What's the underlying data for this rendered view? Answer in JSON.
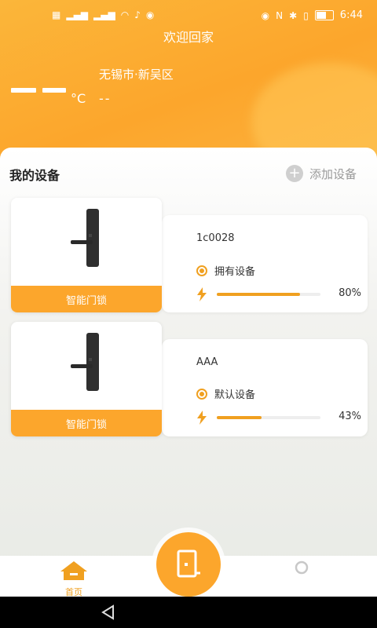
{
  "status_bar": {
    "left_icons": [
      "sim-icon",
      "signal-icon",
      "signal-icon",
      "wifi-icon",
      "notification-icon",
      "app-icon"
    ],
    "time": "6:44"
  },
  "header": {
    "welcome": "欢迎回家",
    "location": "无锡市·新吴区",
    "temp_unit": "°C",
    "temp_extra": "--"
  },
  "devices_section": {
    "title": "我的设备",
    "add_label": "添加设备"
  },
  "devices": [
    {
      "type_label": "智能门锁",
      "name": "1c0028",
      "role": "拥有设备",
      "battery_pct": 80,
      "battery_text": "80%"
    },
    {
      "type_label": "智能门锁",
      "name": "AAA",
      "role": "默认设备",
      "battery_pct": 43,
      "battery_text": "43%"
    }
  ],
  "bottom_nav": {
    "home_label": "首页"
  },
  "colors": {
    "accent": "#fca62c",
    "accent_dark": "#f0a020"
  }
}
